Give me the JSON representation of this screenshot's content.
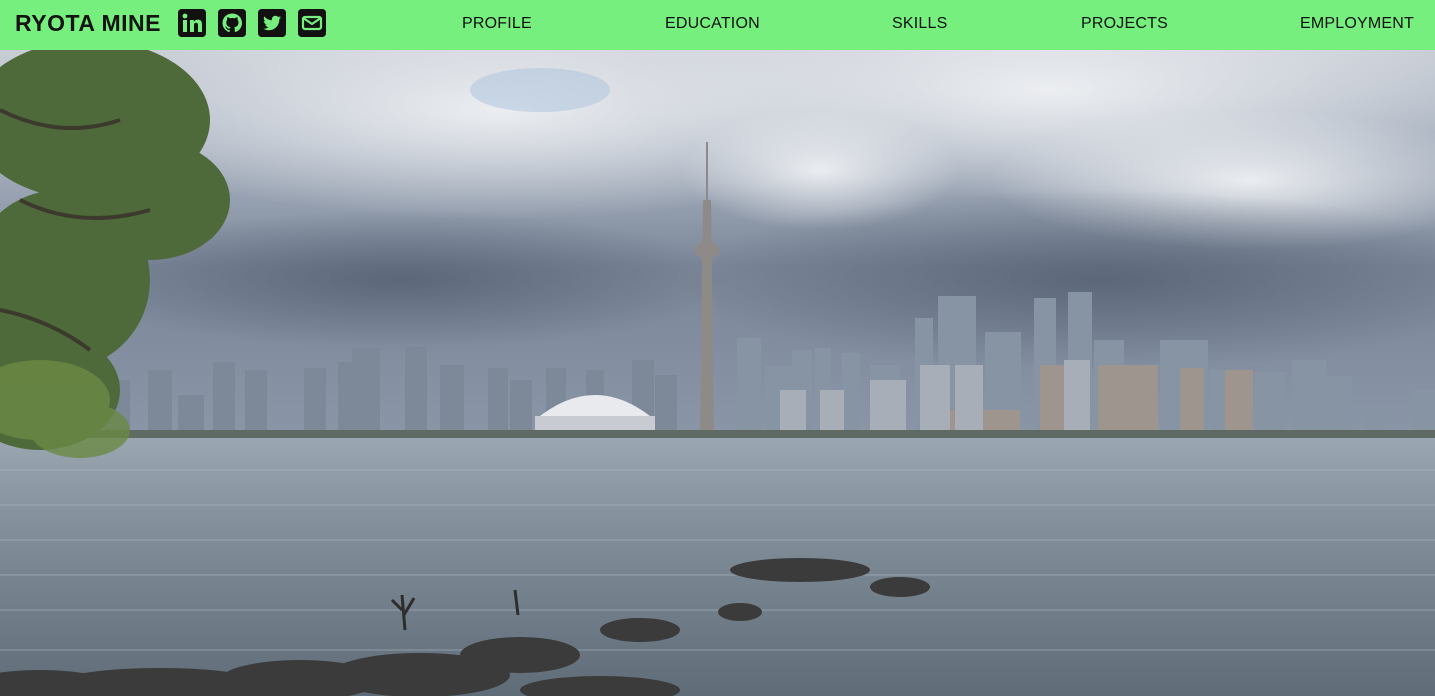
{
  "brand": {
    "name": "RYOTA MINE"
  },
  "social": [
    {
      "icon": "linkedin-icon"
    },
    {
      "icon": "github-icon"
    },
    {
      "icon": "twitter-icon"
    },
    {
      "icon": "email-icon"
    }
  ],
  "nav": {
    "items": [
      {
        "label": "PROFILE"
      },
      {
        "label": "EDUCATION"
      },
      {
        "label": "SKILLS"
      },
      {
        "label": "PROJECTS"
      },
      {
        "label": "EMPLOYMENT"
      }
    ]
  },
  "colors": {
    "navbar_bg": "#76ef7e",
    "text": "#111111"
  }
}
